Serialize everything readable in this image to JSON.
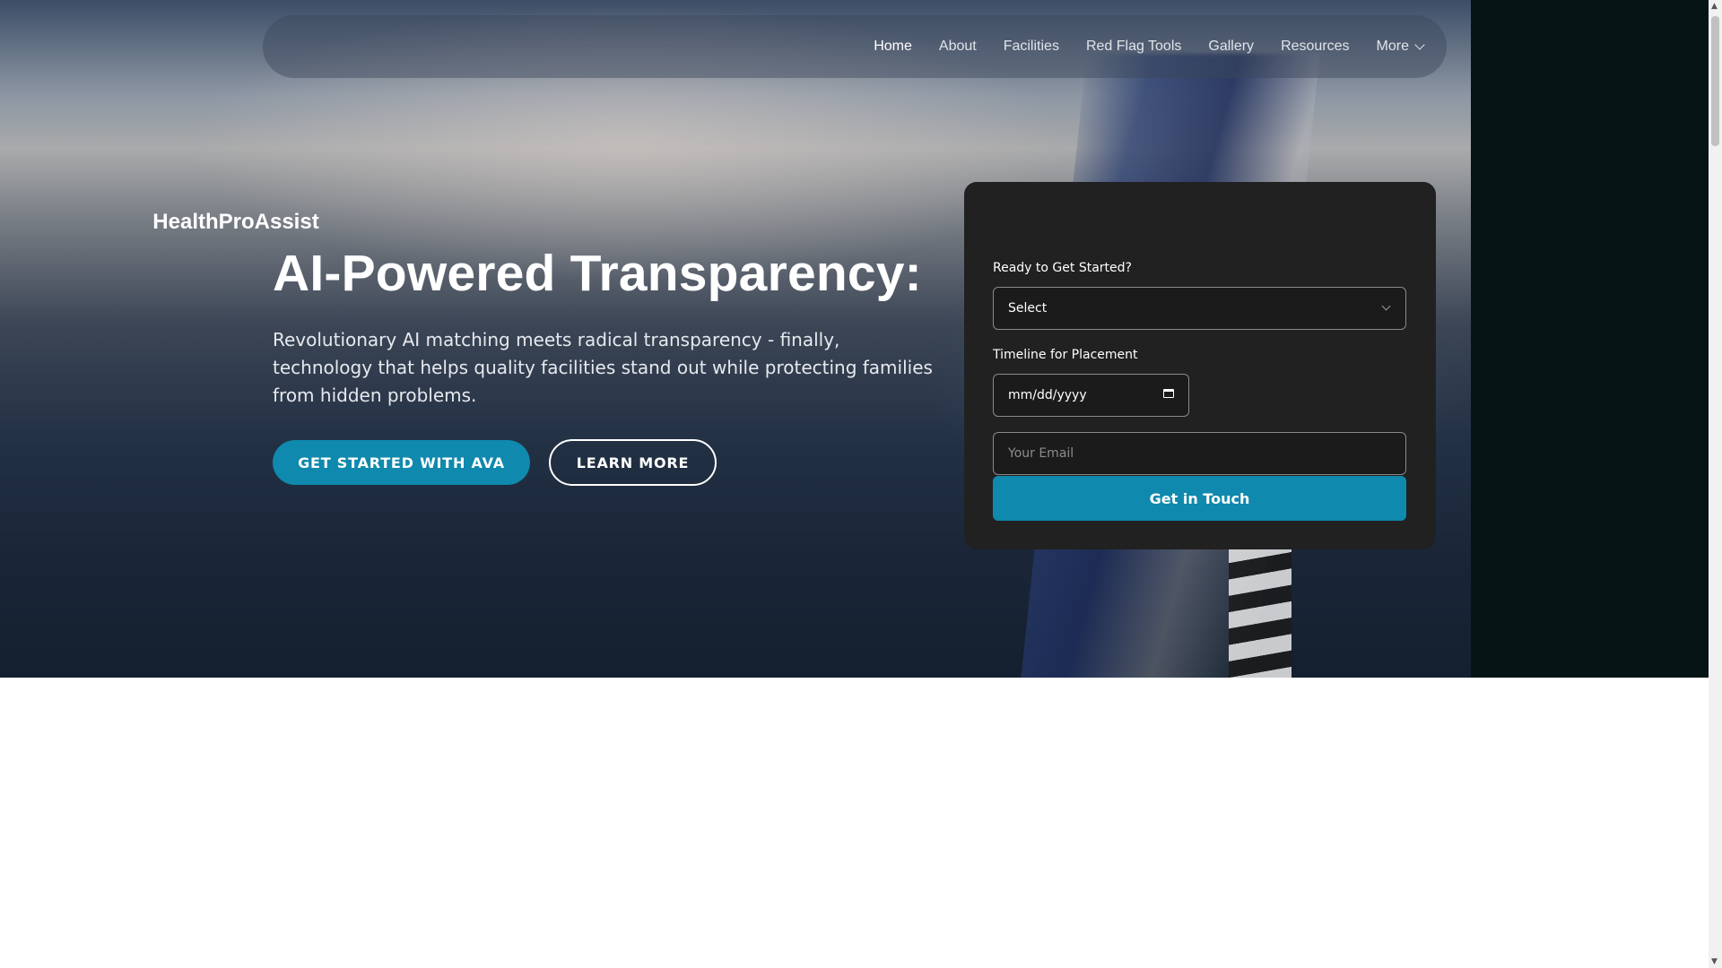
{
  "nav": {
    "items": [
      {
        "label": "Home",
        "active": true
      },
      {
        "label": "About"
      },
      {
        "label": "Facilities"
      },
      {
        "label": "Red Flag Tools"
      },
      {
        "label": "Gallery"
      },
      {
        "label": "Resources"
      },
      {
        "label": "More",
        "icon": "chevron-down-icon"
      }
    ]
  },
  "hero": {
    "title": "AI-Powered Transparency:",
    "subtitle": "Revolutionary AI matching meets radical transparency - finally, technology that helps quality facilities stand out while protecting families from hidden problems.",
    "primary_button": "GET STARTED WITH AVA",
    "secondary_button": "LEARN MORE"
  },
  "form": {
    "title": "HealthProAssist",
    "start_label": "Ready to Get Started?",
    "start_select_value": "Select",
    "timeline_label": "Timeline for Placement",
    "date_placeholder": "mm/dd/yyyy",
    "email_placeholder": "Your Email",
    "submit_label": "Get in Touch"
  },
  "colors": {
    "accent": "#0f89ad",
    "card_bg": "#212121"
  }
}
